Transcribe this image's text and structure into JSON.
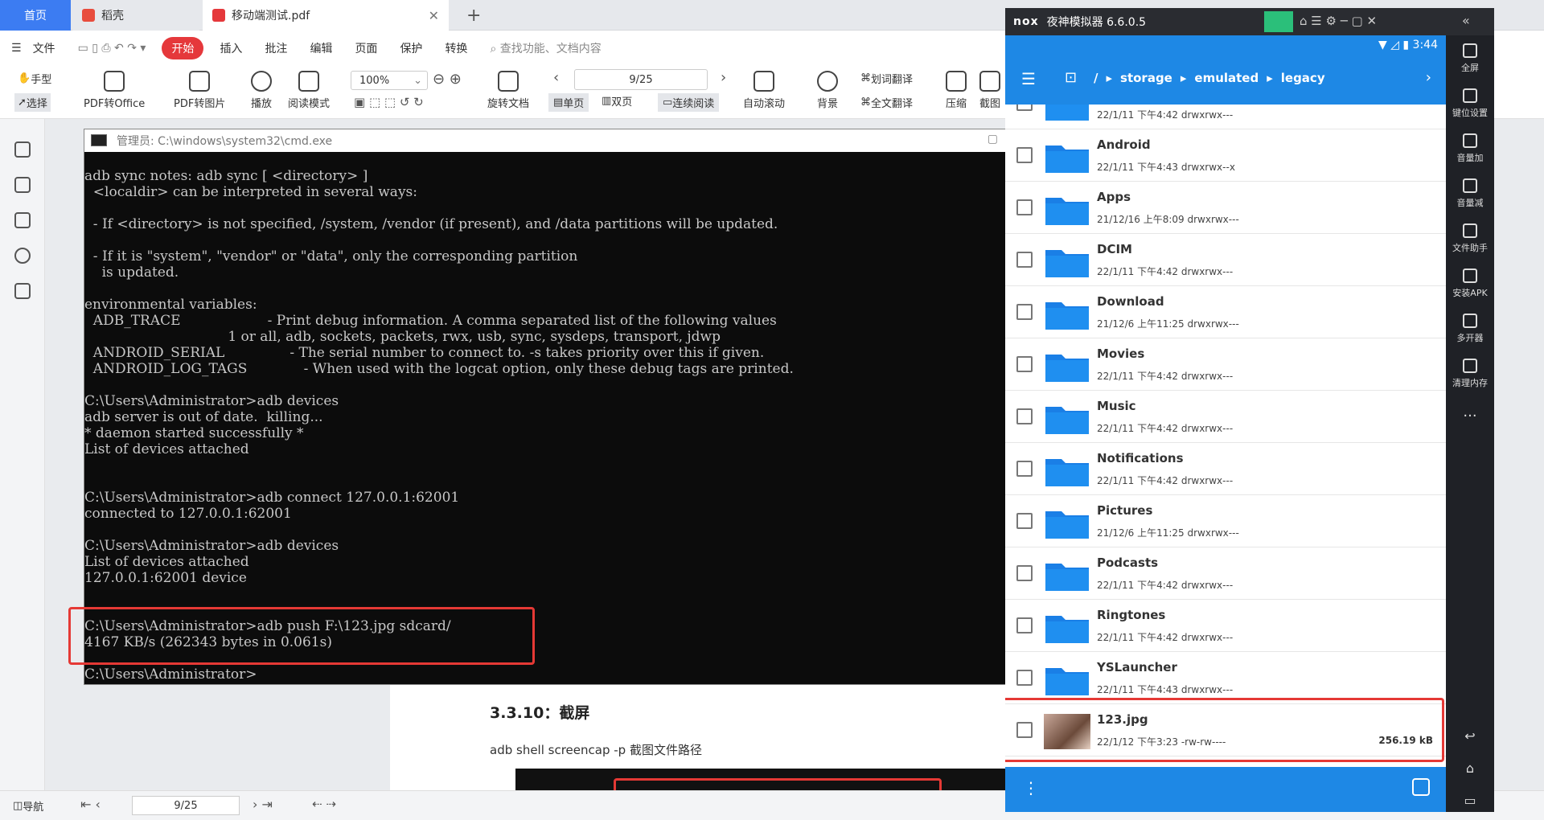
{
  "tabs": {
    "home": "首页",
    "docer": "稻壳",
    "pdf": "移动端测试.pdf",
    "new_tab": "+"
  },
  "menubar": {
    "file": "文件",
    "items": [
      "开始",
      "插入",
      "批注",
      "编辑",
      "页面",
      "保护",
      "转换"
    ],
    "search_placeholder": "查找功能、文档内容"
  },
  "ribbon": {
    "hand": "手型",
    "select": "选择",
    "pdf_to_office": "PDF转Office",
    "pdf_to_image": "PDF转图片",
    "play": "播放",
    "read_mode": "阅读模式",
    "zoom": "100%",
    "page": "9/25",
    "rotate": "旋转文档",
    "single": "单页",
    "double": "双页",
    "continuous": "连续阅读",
    "autoscroll": "自动滚动",
    "background": "背景",
    "word_translate": "划词翻译",
    "full_translate": "全文翻译",
    "compress": "压缩",
    "screenshot": "截图"
  },
  "cmd": {
    "title": "管理员: C:\\windows\\system32\\cmd.exe",
    "lines": [
      "adb sync notes: adb sync [ <directory> ]",
      "  <localdir> can be interpreted in several ways:",
      "",
      "  - If <directory> is not specified, /system, /vendor (if present), and /data partitions will be updated.",
      "",
      "  - If it is \"system\", \"vendor\" or \"data\", only the corresponding partition",
      "    is updated.",
      "",
      "environmental variables:",
      "  ADB_TRACE                    - Print debug information. A comma separated list of the following values",
      "                                 1 or all, adb, sockets, packets, rwx, usb, sync, sysdeps, transport, jdwp",
      "  ANDROID_SERIAL               - The serial number to connect to. -s takes priority over this if given.",
      "  ANDROID_LOG_TAGS             - When used with the logcat option, only these debug tags are printed.",
      "",
      "C:\\Users\\Administrator>adb devices",
      "adb server is out of date.  killing...",
      "* daemon started successfully *",
      "List of devices attached",
      "",
      "",
      "C:\\Users\\Administrator>adb connect 127.0.0.1:62001",
      "connected to 127.0.0.1:62001",
      "",
      "C:\\Users\\Administrator>adb devices",
      "List of devices attached",
      "127.0.0.1:62001 device",
      "",
      "",
      "C:\\Users\\Administrator>adb push F:\\123.jpg sdcard/",
      "4167 KB/s (262343 bytes in 0.061s)",
      "",
      "C:\\Users\\Administrator>"
    ]
  },
  "document": {
    "heading": "3.3.10：截屏",
    "body": "adb shell screencap -p 截图文件路径"
  },
  "statusbar": {
    "nav": "导航",
    "page": "9/25"
  },
  "nox": {
    "title": "夜神模拟器 6.6.0.5",
    "logo": "nox",
    "time": "3:44",
    "path": [
      "/",
      "storage",
      "emulated",
      "legacy"
    ],
    "top_partial_meta": "22/1/11 下午4:42  drwxrwx---",
    "files": [
      {
        "name": "Android",
        "meta": "22/1/11 下午4:43  drwxrwx--x",
        "size": ""
      },
      {
        "name": "Apps",
        "meta": "21/12/16 上午8:09  drwxrwx---",
        "size": ""
      },
      {
        "name": "DCIM",
        "meta": "22/1/11 下午4:42  drwxrwx---",
        "size": ""
      },
      {
        "name": "Download",
        "meta": "21/12/6 上午11:25  drwxrwx---",
        "size": ""
      },
      {
        "name": "Movies",
        "meta": "22/1/11 下午4:42  drwxrwx---",
        "size": ""
      },
      {
        "name": "Music",
        "meta": "22/1/11 下午4:42  drwxrwx---",
        "size": ""
      },
      {
        "name": "Notifications",
        "meta": "22/1/11 下午4:42  drwxrwx---",
        "size": ""
      },
      {
        "name": "Pictures",
        "meta": "21/12/6 上午11:25  drwxrwx---",
        "size": ""
      },
      {
        "name": "Podcasts",
        "meta": "22/1/11 下午4:42  drwxrwx---",
        "size": ""
      },
      {
        "name": "Ringtones",
        "meta": "22/1/11 下午4:42  drwxrwx---",
        "size": ""
      },
      {
        "name": "YSLauncher",
        "meta": "22/1/11 下午4:43  drwxrwx---",
        "size": ""
      }
    ],
    "image_file": {
      "name": "123.jpg",
      "meta": "22/1/12 下午3:23  -rw-rw----",
      "size": "256.19 kB"
    },
    "side": [
      "全屏",
      "键位设置",
      "音量加",
      "音量减",
      "文件助手",
      "安装APK",
      "多开器",
      "清理内存",
      "..."
    ]
  }
}
